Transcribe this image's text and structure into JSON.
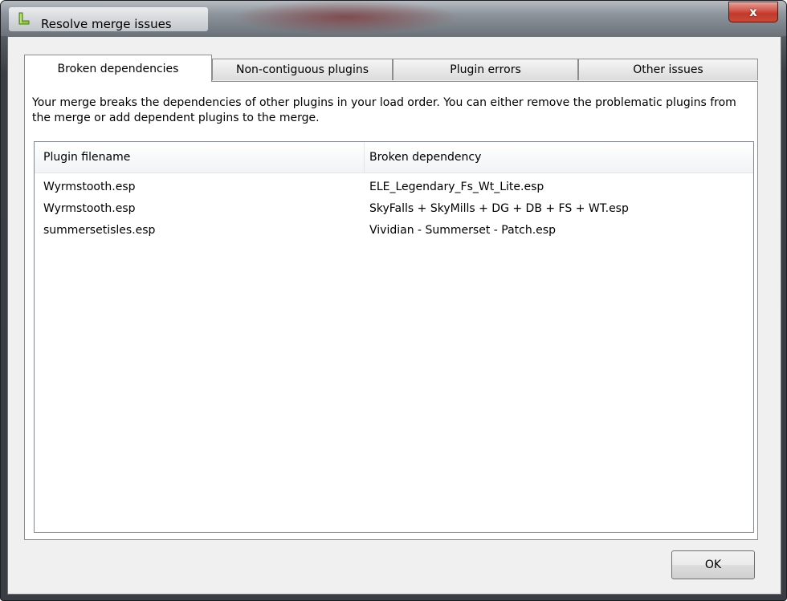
{
  "window": {
    "title": "Resolve merge issues",
    "close_glyph": "x"
  },
  "tabs": [
    {
      "label": "Broken dependencies",
      "active": true
    },
    {
      "label": "Non-contiguous plugins",
      "active": false
    },
    {
      "label": "Plugin errors",
      "active": false
    },
    {
      "label": "Other issues",
      "active": false
    }
  ],
  "panel": {
    "description": "Your merge breaks the dependencies of other plugins in your load order.  You can either remove the problematic plugins from the merge or add dependent plugins to the merge."
  },
  "table": {
    "columns": [
      "Plugin filename",
      "Broken dependency"
    ],
    "rows": [
      [
        "Wyrmstooth.esp",
        "ELE_Legendary_Fs_Wt_Lite.esp"
      ],
      [
        "Wyrmstooth.esp",
        "SkyFalls + SkyMills + DG + DB + FS + WT.esp"
      ],
      [
        "summersetisles.esp",
        "Vividian - Summerset - Patch.esp"
      ]
    ]
  },
  "buttons": {
    "ok_label": "OK"
  },
  "colors": {
    "frame_dark": "#3a3e44",
    "close_red": "#c84b3a",
    "client_bg": "#f0f0f0",
    "app_icon_green": "#8dc63f"
  },
  "icons": {
    "app_icon": "merge-arrow-icon",
    "close_icon": "close-icon"
  }
}
